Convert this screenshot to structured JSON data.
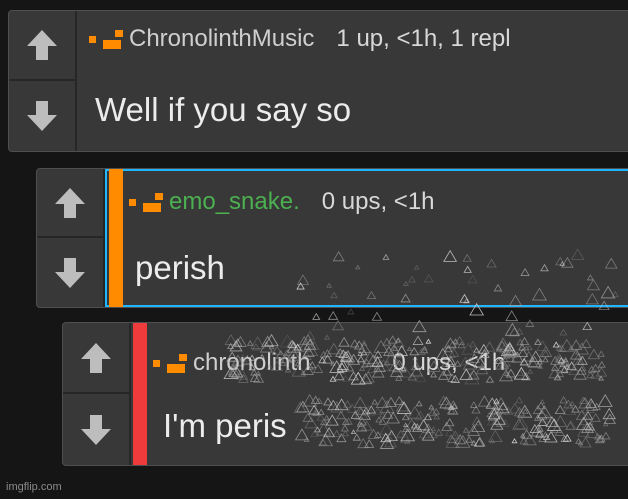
{
  "comments": [
    {
      "username": "ChronolinthMusic",
      "meta": "1 up, <1h, 1 repl",
      "text": "Well if you say so",
      "username_color": "#cfcfcf"
    },
    {
      "username": "emo_snake.",
      "meta": "0 ups, <1h",
      "text": "perish",
      "username_color": "#4caf50",
      "level_color": "#ff8c00",
      "highlight_color": "#1fb6ff"
    },
    {
      "username": "chronolinth",
      "meta": "0 ups, <1h",
      "text": "I'm peris",
      "username_color": "#cfcfcf",
      "level_color": "#ef3b3b"
    }
  ],
  "badge_color": "#ff8c00",
  "icons": {
    "upvote": "arrow-up-icon",
    "downvote": "arrow-down-icon",
    "badge": "user-level-badge-icon"
  },
  "watermark": "imgflip.com"
}
